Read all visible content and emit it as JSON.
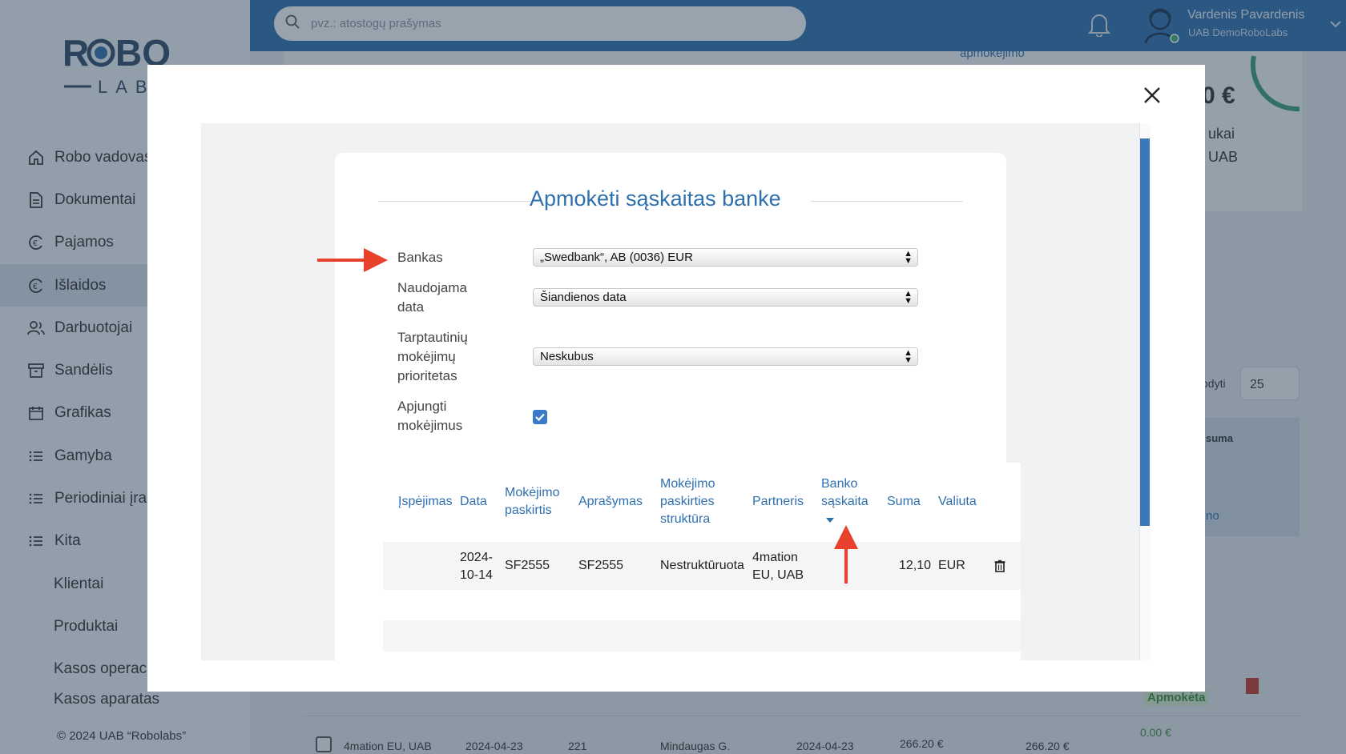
{
  "app": {
    "brand": "ROBO LABS",
    "search_placeholder": "pvz.: atostogų prašymas",
    "user_name": "Vardenis Pavardenis",
    "user_company": "UAB DemoRoboLabs",
    "copyright": "© 2024 UAB “Robolabs”"
  },
  "sidebar": {
    "items": [
      {
        "label": "Robo vadovas",
        "icon": "home-icon"
      },
      {
        "label": "Dokumentai",
        "icon": "document-icon"
      },
      {
        "label": "Pajamos",
        "icon": "euro-in-icon"
      },
      {
        "label": "Išlaidos",
        "icon": "euro-out-icon",
        "active": true
      },
      {
        "label": "Darbuotojai",
        "icon": "users-icon"
      },
      {
        "label": "Sandėlis",
        "icon": "archive-icon"
      },
      {
        "label": "Grafikas",
        "icon": "calendar-icon"
      },
      {
        "label": "Gamyba",
        "icon": "list-icon"
      },
      {
        "label": "Periodiniai įrašai",
        "icon": "list-icon"
      },
      {
        "label": "Kita",
        "icon": "list-icon"
      }
    ],
    "subitems": [
      "Klientai",
      "Produktai",
      "Kasos operacijos",
      "Kasos aparatas"
    ]
  },
  "background": {
    "card_label": "apmokėjimo",
    "amount_partial": "0 €",
    "line1": "ukai",
    "line2": "UAB",
    "rodyti": "odyti",
    "page_size": "25",
    "col_suma": "suma",
    "link_partial": "no",
    "status_paid": "Apmokėta",
    "row_partner": "4mation EU, UAB",
    "row_date": "2024-04-23",
    "row_number": "221",
    "row_person": "Mindaugas G.",
    "row_date2": "2024-04-23",
    "row_amount": "266.20 €",
    "row_amount2": "266.20 €",
    "row_paid": "0.00 €"
  },
  "modal": {
    "title": "Apmokėti sąskaitas banke",
    "fields": {
      "bank_label": "Bankas",
      "bank_value": "„Swedbank“, AB (0036) EUR",
      "date_label": [
        "Naudojama",
        "data"
      ],
      "date_value": "Šiandienos data",
      "priority_label": [
        "Tarptautinių",
        "mokėjimų",
        "prioritetas"
      ],
      "priority_value": "Neskubus",
      "merge_label": [
        "Apjungti",
        "mokėjimus"
      ],
      "merge_checked": true
    },
    "table": {
      "columns": [
        [
          "Įspėjimas"
        ],
        [
          "Data"
        ],
        [
          "Mokėjimo",
          "paskirtis"
        ],
        [
          "Aprašymas"
        ],
        [
          "Mokėjimo",
          "paskirties",
          "struktūra"
        ],
        [
          "Partneris"
        ],
        [
          "Banko",
          "sąskaita"
        ],
        [
          "Suma"
        ],
        [
          "Valiuta"
        ]
      ],
      "rows": [
        {
          "warning": "",
          "date": [
            "2024-",
            "10-14"
          ],
          "purpose": "SF2555",
          "description": "SF2555",
          "structure": "Nestruktūruota",
          "partner": [
            "4mation",
            "EU, UAB"
          ],
          "bank_account": "",
          "amount": "12,10",
          "currency": "EUR"
        }
      ]
    }
  },
  "colors": {
    "accent": "#2e6fae",
    "annotation": "#e8412c",
    "checkbox": "#3a7ac8"
  }
}
